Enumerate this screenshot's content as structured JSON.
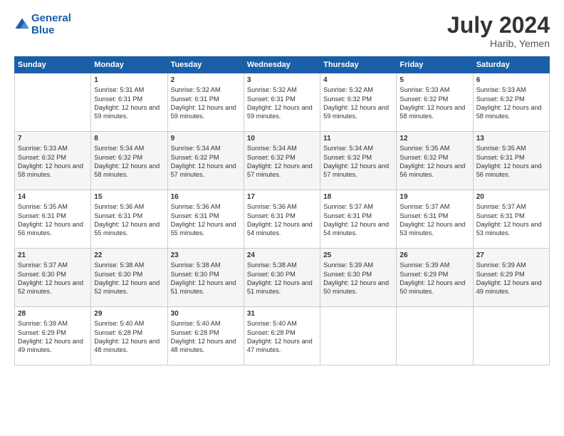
{
  "logo": {
    "line1": "General",
    "line2": "Blue"
  },
  "title": "July 2024",
  "subtitle": "Harib, Yemen",
  "days_header": [
    "Sunday",
    "Monday",
    "Tuesday",
    "Wednesday",
    "Thursday",
    "Friday",
    "Saturday"
  ],
  "weeks": [
    [
      {
        "day": "",
        "sunrise": "",
        "sunset": "",
        "daylight": ""
      },
      {
        "day": "1",
        "sunrise": "Sunrise: 5:31 AM",
        "sunset": "Sunset: 6:31 PM",
        "daylight": "Daylight: 12 hours and 59 minutes."
      },
      {
        "day": "2",
        "sunrise": "Sunrise: 5:32 AM",
        "sunset": "Sunset: 6:31 PM",
        "daylight": "Daylight: 12 hours and 59 minutes."
      },
      {
        "day": "3",
        "sunrise": "Sunrise: 5:32 AM",
        "sunset": "Sunset: 6:31 PM",
        "daylight": "Daylight: 12 hours and 59 minutes."
      },
      {
        "day": "4",
        "sunrise": "Sunrise: 5:32 AM",
        "sunset": "Sunset: 6:32 PM",
        "daylight": "Daylight: 12 hours and 59 minutes."
      },
      {
        "day": "5",
        "sunrise": "Sunrise: 5:33 AM",
        "sunset": "Sunset: 6:32 PM",
        "daylight": "Daylight: 12 hours and 58 minutes."
      },
      {
        "day": "6",
        "sunrise": "Sunrise: 5:33 AM",
        "sunset": "Sunset: 6:32 PM",
        "daylight": "Daylight: 12 hours and 58 minutes."
      }
    ],
    [
      {
        "day": "7",
        "sunrise": "Sunrise: 5:33 AM",
        "sunset": "Sunset: 6:32 PM",
        "daylight": "Daylight: 12 hours and 58 minutes."
      },
      {
        "day": "8",
        "sunrise": "Sunrise: 5:34 AM",
        "sunset": "Sunset: 6:32 PM",
        "daylight": "Daylight: 12 hours and 58 minutes."
      },
      {
        "day": "9",
        "sunrise": "Sunrise: 5:34 AM",
        "sunset": "Sunset: 6:32 PM",
        "daylight": "Daylight: 12 hours and 57 minutes."
      },
      {
        "day": "10",
        "sunrise": "Sunrise: 5:34 AM",
        "sunset": "Sunset: 6:32 PM",
        "daylight": "Daylight: 12 hours and 57 minutes."
      },
      {
        "day": "11",
        "sunrise": "Sunrise: 5:34 AM",
        "sunset": "Sunset: 6:32 PM",
        "daylight": "Daylight: 12 hours and 57 minutes."
      },
      {
        "day": "12",
        "sunrise": "Sunrise: 5:35 AM",
        "sunset": "Sunset: 6:32 PM",
        "daylight": "Daylight: 12 hours and 56 minutes."
      },
      {
        "day": "13",
        "sunrise": "Sunrise: 5:35 AM",
        "sunset": "Sunset: 6:31 PM",
        "daylight": "Daylight: 12 hours and 56 minutes."
      }
    ],
    [
      {
        "day": "14",
        "sunrise": "Sunrise: 5:35 AM",
        "sunset": "Sunset: 6:31 PM",
        "daylight": "Daylight: 12 hours and 56 minutes."
      },
      {
        "day": "15",
        "sunrise": "Sunrise: 5:36 AM",
        "sunset": "Sunset: 6:31 PM",
        "daylight": "Daylight: 12 hours and 55 minutes."
      },
      {
        "day": "16",
        "sunrise": "Sunrise: 5:36 AM",
        "sunset": "Sunset: 6:31 PM",
        "daylight": "Daylight: 12 hours and 55 minutes."
      },
      {
        "day": "17",
        "sunrise": "Sunrise: 5:36 AM",
        "sunset": "Sunset: 6:31 PM",
        "daylight": "Daylight: 12 hours and 54 minutes."
      },
      {
        "day": "18",
        "sunrise": "Sunrise: 5:37 AM",
        "sunset": "Sunset: 6:31 PM",
        "daylight": "Daylight: 12 hours and 54 minutes."
      },
      {
        "day": "19",
        "sunrise": "Sunrise: 5:37 AM",
        "sunset": "Sunset: 6:31 PM",
        "daylight": "Daylight: 12 hours and 53 minutes."
      },
      {
        "day": "20",
        "sunrise": "Sunrise: 5:37 AM",
        "sunset": "Sunset: 6:31 PM",
        "daylight": "Daylight: 12 hours and 53 minutes."
      }
    ],
    [
      {
        "day": "21",
        "sunrise": "Sunrise: 5:37 AM",
        "sunset": "Sunset: 6:30 PM",
        "daylight": "Daylight: 12 hours and 52 minutes."
      },
      {
        "day": "22",
        "sunrise": "Sunrise: 5:38 AM",
        "sunset": "Sunset: 6:30 PM",
        "daylight": "Daylight: 12 hours and 52 minutes."
      },
      {
        "day": "23",
        "sunrise": "Sunrise: 5:38 AM",
        "sunset": "Sunset: 6:30 PM",
        "daylight": "Daylight: 12 hours and 51 minutes."
      },
      {
        "day": "24",
        "sunrise": "Sunrise: 5:38 AM",
        "sunset": "Sunset: 6:30 PM",
        "daylight": "Daylight: 12 hours and 51 minutes."
      },
      {
        "day": "25",
        "sunrise": "Sunrise: 5:39 AM",
        "sunset": "Sunset: 6:30 PM",
        "daylight": "Daylight: 12 hours and 50 minutes."
      },
      {
        "day": "26",
        "sunrise": "Sunrise: 5:39 AM",
        "sunset": "Sunset: 6:29 PM",
        "daylight": "Daylight: 12 hours and 50 minutes."
      },
      {
        "day": "27",
        "sunrise": "Sunrise: 5:39 AM",
        "sunset": "Sunset: 6:29 PM",
        "daylight": "Daylight: 12 hours and 49 minutes."
      }
    ],
    [
      {
        "day": "28",
        "sunrise": "Sunrise: 5:39 AM",
        "sunset": "Sunset: 6:29 PM",
        "daylight": "Daylight: 12 hours and 49 minutes."
      },
      {
        "day": "29",
        "sunrise": "Sunrise: 5:40 AM",
        "sunset": "Sunset: 6:28 PM",
        "daylight": "Daylight: 12 hours and 48 minutes."
      },
      {
        "day": "30",
        "sunrise": "Sunrise: 5:40 AM",
        "sunset": "Sunset: 6:28 PM",
        "daylight": "Daylight: 12 hours and 48 minutes."
      },
      {
        "day": "31",
        "sunrise": "Sunrise: 5:40 AM",
        "sunset": "Sunset: 6:28 PM",
        "daylight": "Daylight: 12 hours and 47 minutes."
      },
      {
        "day": "",
        "sunrise": "",
        "sunset": "",
        "daylight": ""
      },
      {
        "day": "",
        "sunrise": "",
        "sunset": "",
        "daylight": ""
      },
      {
        "day": "",
        "sunrise": "",
        "sunset": "",
        "daylight": ""
      }
    ]
  ]
}
